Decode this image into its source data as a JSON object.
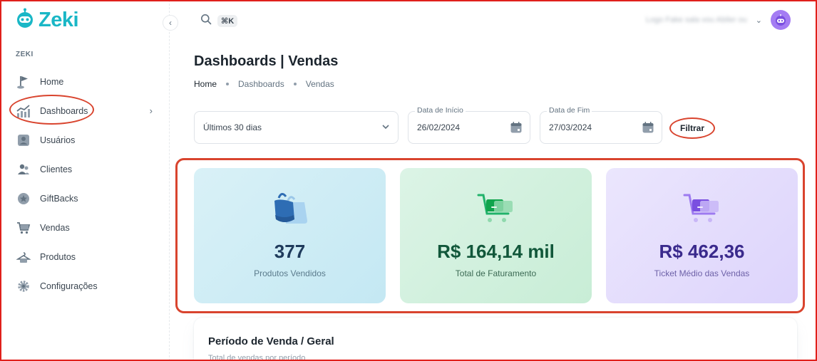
{
  "app": {
    "logo_text": "Zeki"
  },
  "sidebar": {
    "section_label": "ZEKI",
    "items": [
      {
        "label": "Home",
        "icon": "home-flag-icon"
      },
      {
        "label": "Dashboards",
        "icon": "chart-icon"
      },
      {
        "label": "Usuários",
        "icon": "user-badge-icon"
      },
      {
        "label": "Clientes",
        "icon": "users-icon"
      },
      {
        "label": "GiftBacks",
        "icon": "star-badge-icon"
      },
      {
        "label": "Vendas",
        "icon": "cart-icon"
      },
      {
        "label": "Produtos",
        "icon": "hanger-icon"
      },
      {
        "label": "Configurações",
        "icon": "gear-icon"
      }
    ]
  },
  "topbar": {
    "shortcut": "⌘K",
    "account_name": "Logo Fake sala vou Abiler ou"
  },
  "page": {
    "title": "Dashboards | Vendas",
    "breadcrumb": [
      "Home",
      "Dashboards",
      "Vendas"
    ]
  },
  "filters": {
    "period_value": "Últimos 30 dias",
    "start_label": "Data de Início",
    "start_value": "26/02/2024",
    "end_label": "Data de Fim",
    "end_value": "27/03/2024",
    "filter_button": "Filtrar"
  },
  "cards": [
    {
      "value": "377",
      "label": "Produtos Vendidos",
      "icon": "shopping-bags-icon"
    },
    {
      "value": "R$ 164,14 mil",
      "label": "Total de Faturamento",
      "icon": "cart-icon"
    },
    {
      "value": "R$ 462,36",
      "label": "Ticket Médio das Vendas",
      "icon": "cart-icon"
    }
  ],
  "panel": {
    "title": "Período de Venda / Geral",
    "subtitle": "Total de vendas por período"
  },
  "colors": {
    "brand": "#1ab7c6",
    "highlight": "#d9442e",
    "card_blue": "#c4e8f3",
    "card_green": "#c8edd6",
    "card_purple": "#ddd4fc"
  }
}
